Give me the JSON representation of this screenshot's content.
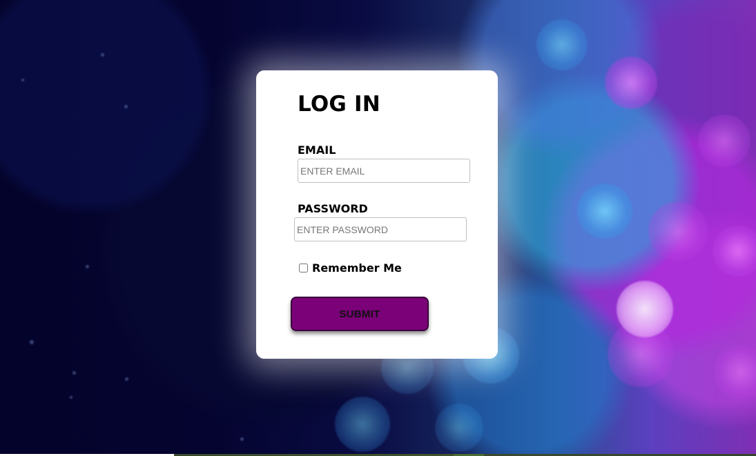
{
  "login": {
    "title": "LOG IN",
    "email_label": "EMAIL",
    "email_value": "",
    "email_placeholder": "ENTER EMAIL",
    "password_label": "PASSWORD",
    "password_value": "",
    "password_placeholder": "ENTER PASSWORD",
    "remember_label": "Remember Me",
    "remember_checked": false,
    "submit_label": "SUBMIT"
  },
  "theme": {
    "card_background": "#ffffff",
    "text_color": "#000000",
    "input_border": "#bfbfbf",
    "submit_background": "#7a0177",
    "submit_border": "#3b003a",
    "background_colors": [
      "#04032b",
      "#18265f",
      "#2a4c92",
      "#5b40bf",
      "#7f2fb4"
    ]
  }
}
